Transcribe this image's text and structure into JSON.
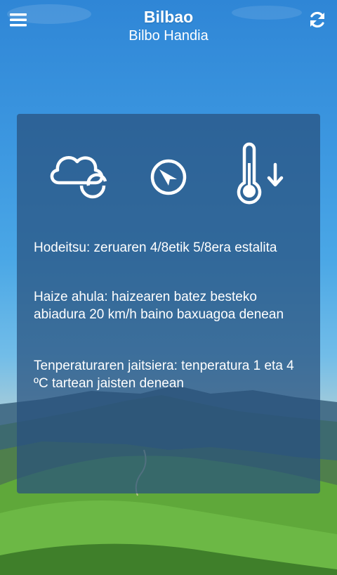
{
  "header": {
    "city": "Bilbao",
    "region": "Bilbo Handia",
    "menu_icon": "menu-icon",
    "refresh_icon": "refresh-icon"
  },
  "forecast": {
    "icons": [
      "cloudy-icon",
      "wind-direction-icon",
      "temperature-down-icon"
    ],
    "descriptions": [
      "Hodeitsu: zeruaren 4/8etik 5/8era estalita",
      "Haize ahula: haizearen batez besteko abiadura 20 km/h baino baxuagoa denean",
      "Tenperaturaren jaitsiera: tenperatura 1 eta 4 ºC tartean jaisten denean"
    ]
  },
  "colors": {
    "sky_top": "#2f86d6",
    "card_bg": "#28507d",
    "grass": "#5fa83a"
  }
}
